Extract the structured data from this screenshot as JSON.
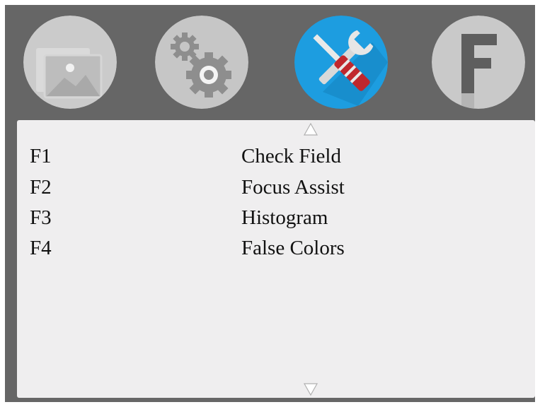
{
  "tabs": [
    {
      "id": "picture",
      "icon": "picture-icon",
      "active": false
    },
    {
      "id": "setup",
      "icon": "gears-icon",
      "active": false
    },
    {
      "id": "tools",
      "icon": "tools-icon",
      "active": true
    },
    {
      "id": "function",
      "icon": "function-f-icon",
      "active": false
    }
  ],
  "colors": {
    "background": "#666666",
    "panel": "#efeeef",
    "active_tab": "#1d9de0",
    "inactive_tab": "#c9c9c9",
    "text": "#111111"
  },
  "menu": {
    "items": [
      {
        "key": "F1",
        "label": "Check Field"
      },
      {
        "key": "F2",
        "label": "Focus Assist"
      },
      {
        "key": "F3",
        "label": "Histogram"
      },
      {
        "key": "F4",
        "label": "False Colors"
      }
    ]
  },
  "scroll": {
    "up_icon": "triangle-up-icon",
    "down_icon": "triangle-down-icon"
  }
}
